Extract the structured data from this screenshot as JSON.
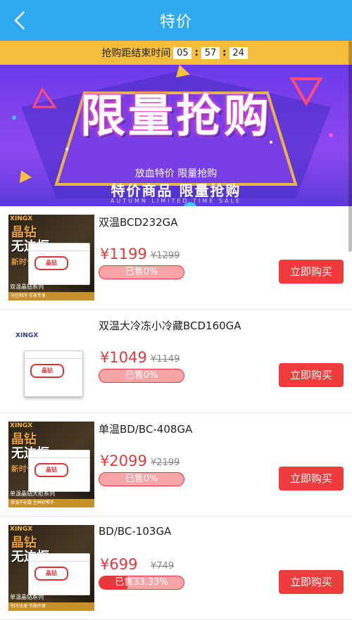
{
  "header": {
    "title": "特价",
    "back_icon": "chevron-left-icon"
  },
  "countdown": {
    "label": "抢购距结束时间",
    "hours": "05",
    "minutes": "57",
    "seconds": "24"
  },
  "banner": {
    "title": "限量抢购",
    "subtitle1": "放血特价 限量抢购",
    "subtitle2": "特价商品 限量抢购",
    "subtitle3": "AUTUMN LIMITED TIME SALE"
  },
  "products": [
    {
      "name": "双温BCD232GA",
      "price": "¥1199",
      "old_price": "¥1299",
      "sold": "已售0%",
      "sold_fraction": 0,
      "buy": "立即购买",
      "thumb": {
        "style": "dark",
        "brand": "XINGX",
        "slogan1": "晶钻",
        "slogan2": "无边框",
        "slogan3": "新时代",
        "series": "双温晶钻系列",
        "tagline": "分区制冷 存放专享"
      }
    },
    {
      "name": "双温大冷冻小冷藏BCD160GA",
      "price": "¥1049",
      "old_price": "¥1149",
      "sold": "已售0%",
      "sold_fraction": 0,
      "buy": "立即购买",
      "thumb": {
        "style": "light",
        "brand": "XINGX"
      }
    },
    {
      "name": "单温BD/BC-408GA",
      "price": "¥2099",
      "old_price": "¥2199",
      "sold": "已售0%",
      "sold_fraction": 0,
      "buy": "立即购买",
      "thumb": {
        "style": "dark",
        "brand": "XINGX",
        "slogan1": "晶钻",
        "slogan2": "无边框",
        "slogan3": "新时代",
        "series": "单温晶钻大柜系列",
        "tagline": "单温不化霜 生鲜好帮手"
      }
    },
    {
      "name": "BD/BC-103GA",
      "price": "¥699",
      "old_price": "¥749",
      "sold": "已售33.33%",
      "sold_fraction": 0.3333,
      "buy": "立即购买",
      "thumb": {
        "style": "dark",
        "brand": "XINGX",
        "slogan1": "晶钻",
        "slogan2": "无边框",
        "slogan3": "",
        "series": "单温晶钻系列",
        "tagline": "制冷迅速 节能环保"
      }
    }
  ],
  "colors": {
    "header": "#2fa9f0",
    "countdown_bar": "#f4be3c",
    "price": "#e8383d",
    "buy_button": "#ee3b3b"
  }
}
